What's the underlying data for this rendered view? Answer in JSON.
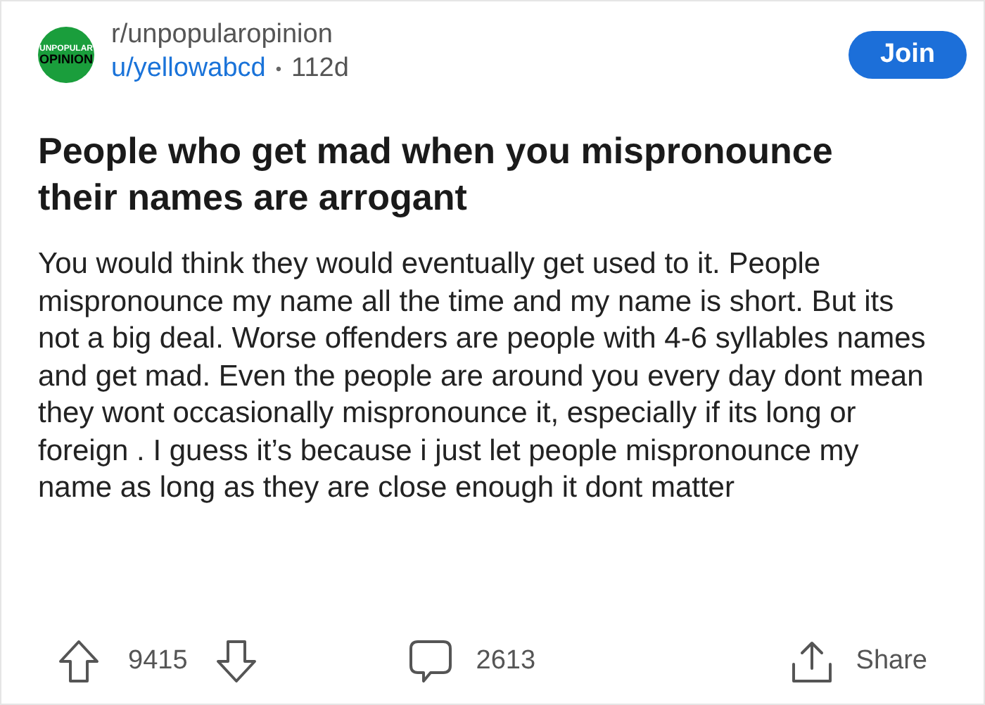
{
  "community": {
    "logo_text": [
      "UNPOPULAR",
      "OPINION"
    ],
    "name": "r/unpopularopinion"
  },
  "author": "u/yellowabcd",
  "separator": "•",
  "age": "112d",
  "join_button": "Join",
  "title": "People who get mad when you mispronounce their names are arrogant",
  "body": "You would think they would eventually get used to it. People mispronounce my name all the time and my name is short. But its not a big deal. Worse offenders are people with 4-6 syllables names and get mad. Even the people are around you every day dont mean they wont occasionally mispronounce it, especially if its long or foreign . I guess it’s because i just let people mispronounce my name as long as they are close enough it dont matter",
  "actions": {
    "upvotes": "9415",
    "comments": "2613",
    "share": "Share"
  }
}
